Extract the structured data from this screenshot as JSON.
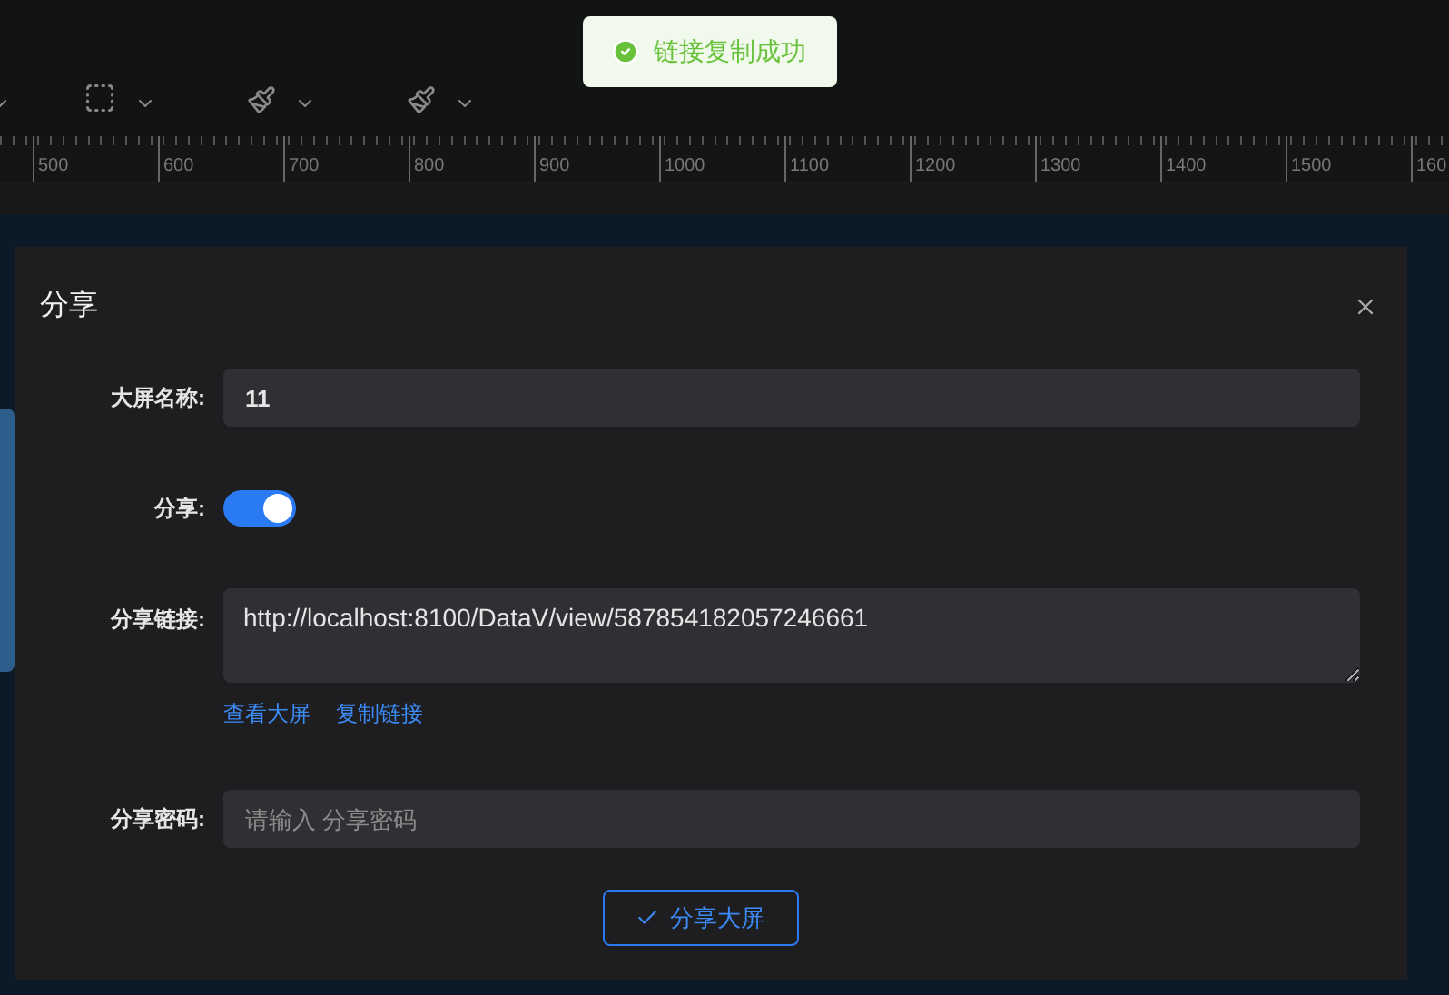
{
  "toast": {
    "message": "链接复制成功"
  },
  "ruler": {
    "labels": [
      "500",
      "600",
      "700",
      "800",
      "900",
      "1000",
      "1100",
      "1200",
      "1300",
      "1400",
      "1500",
      "160"
    ]
  },
  "dialog": {
    "title": "分享",
    "name_field": {
      "label": "大屏名称:",
      "value": "11"
    },
    "share_switch": {
      "label": "分享:",
      "on": true
    },
    "link_field": {
      "label": "分享链接:",
      "value": "http://localhost:8100/DataV/view/587854182057246661"
    },
    "links": [
      "查看大屏",
      "复制链接"
    ],
    "password_field": {
      "label": "分享密码:",
      "placeholder": "请输入 分享密码"
    },
    "submit_button": "分享大屏"
  }
}
